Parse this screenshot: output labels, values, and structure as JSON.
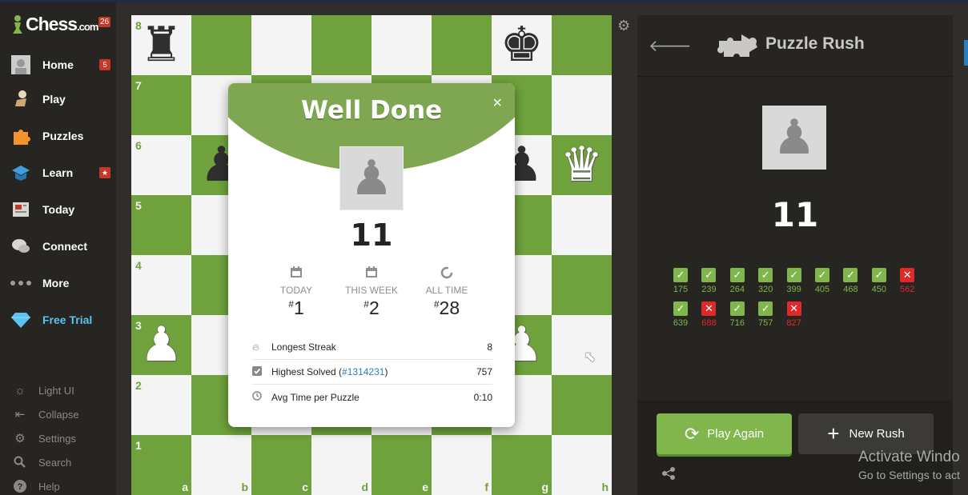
{
  "sidebar": {
    "logo_text": "Chess",
    "logo_suffix": ".com",
    "logo_badge": "26",
    "items": [
      {
        "label": "Home",
        "badge": "5",
        "icon": "avatar-icon"
      },
      {
        "label": "Play",
        "badge": "",
        "icon": "hand-pawn-icon"
      },
      {
        "label": "Puzzles",
        "badge": "",
        "icon": "puzzle-piece-icon"
      },
      {
        "label": "Learn",
        "badge": "★",
        "icon": "graduation-cap-icon"
      },
      {
        "label": "Today",
        "badge": "",
        "icon": "newspaper-icon"
      },
      {
        "label": "Connect",
        "badge": "",
        "icon": "chat-bubbles-icon"
      },
      {
        "label": "More",
        "badge": "",
        "icon": "more-dots-icon"
      },
      {
        "label": "Free Trial",
        "badge": "",
        "icon": "diamond-icon"
      }
    ],
    "bottom": [
      {
        "label": "Light UI",
        "icon": "sun-icon"
      },
      {
        "label": "Collapse",
        "icon": "collapse-icon"
      },
      {
        "label": "Settings",
        "icon": "gear-icon"
      },
      {
        "label": "Search",
        "icon": "search-icon"
      },
      {
        "label": "Help",
        "icon": "help-icon"
      }
    ]
  },
  "board": {
    "ranks": [
      "8",
      "7",
      "6",
      "5",
      "4",
      "3",
      "2",
      "1"
    ],
    "files": [
      "a",
      "b",
      "c",
      "d",
      "e",
      "f",
      "g",
      "h"
    ],
    "pieces": [
      {
        "square": "a8",
        "glyph": "♜",
        "color": "black"
      },
      {
        "square": "g8",
        "glyph": "♚",
        "color": "black"
      },
      {
        "square": "b6",
        "glyph": "♟",
        "color": "black"
      },
      {
        "square": "g6",
        "glyph": "♟",
        "color": "black"
      },
      {
        "square": "h6",
        "glyph": "♛",
        "color": "white"
      },
      {
        "square": "a3",
        "glyph": "♟",
        "color": "white"
      },
      {
        "square": "g3",
        "glyph": "♟",
        "color": "white"
      }
    ],
    "light_color": "#f4f4f4",
    "dark_color": "#6fa23c"
  },
  "modal": {
    "title": "Well Done",
    "close": "×",
    "score": "11",
    "stats": [
      {
        "label": "TODAY",
        "hash": "#",
        "rank": "1"
      },
      {
        "label": "THIS WEEK",
        "hash": "#",
        "rank": "2"
      },
      {
        "label": "ALL TIME",
        "hash": "#",
        "rank": "28"
      }
    ],
    "rows": {
      "streak_label": "Longest Streak",
      "streak_value": "8",
      "highest_prefix": "Highest Solved (",
      "highest_link": "#1314231",
      "highest_suffix": ")",
      "highest_value": "757",
      "avg_label": "Avg Time per Puzzle",
      "avg_value": "0:10"
    }
  },
  "panel": {
    "title": "Puzzle Rush",
    "score": "11",
    "results": [
      {
        "value": "175",
        "ok": true
      },
      {
        "value": "239",
        "ok": true
      },
      {
        "value": "264",
        "ok": true
      },
      {
        "value": "320",
        "ok": true
      },
      {
        "value": "399",
        "ok": true
      },
      {
        "value": "405",
        "ok": true
      },
      {
        "value": "468",
        "ok": true
      },
      {
        "value": "450",
        "ok": true
      },
      {
        "value": "562",
        "ok": false
      },
      {
        "value": "639",
        "ok": true
      },
      {
        "value": "688",
        "ok": false
      },
      {
        "value": "716",
        "ok": true
      },
      {
        "value": "757",
        "ok": true
      },
      {
        "value": "827",
        "ok": false
      }
    ],
    "play_again": "Play Again",
    "new_rush": "New Rush"
  },
  "watermark": {
    "line1": "Activate Windo",
    "line2": "Go to Settings to act"
  },
  "colors": {
    "accent_green": "#81b64c",
    "error_red": "#e02828",
    "link_blue": "#2b7fc0"
  }
}
